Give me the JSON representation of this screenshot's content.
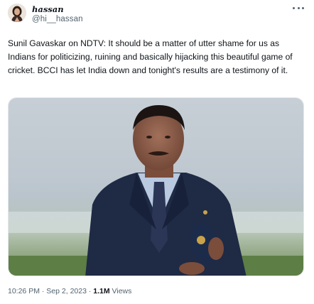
{
  "author": {
    "display_name": "hassan",
    "handle": "@hi__hassan"
  },
  "tweet": {
    "text": "Sunil Gavaskar on NDTV: It should be a matter of utter shame for us as Indians for politicizing, ruining and basically hijacking this beautiful game of cricket. BCCI has let India down and tonight's results are a testimony of it."
  },
  "meta": {
    "time": "10:26 PM",
    "separator": "·",
    "date": "Sep 2, 2023",
    "separator2": "·",
    "views_count": "1.1M",
    "views_label": "Views"
  },
  "icons": {
    "more": "more-horizontal-icon",
    "avatar": "avatar-image"
  },
  "colors": {
    "text_primary": "#0f1419",
    "text_secondary": "#536471"
  }
}
